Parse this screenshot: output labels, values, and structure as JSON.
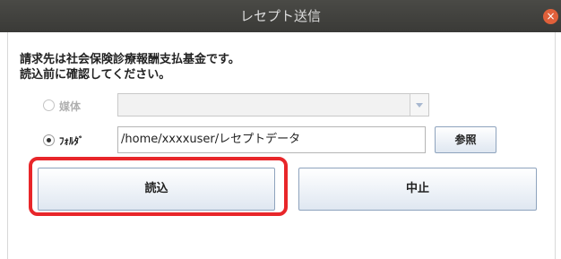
{
  "window": {
    "title": "レセプト送信",
    "close_glyph": "×"
  },
  "message": {
    "line1": "請求先は社会保険診療報酬支払基金です。",
    "line2": "読込前に確認してください。"
  },
  "source": {
    "media_label": "媒体",
    "media_selected": false,
    "media_value": "",
    "folder_label": "ﾌｫﾙﾀﾞ",
    "folder_selected": true,
    "folder_path": "/home/xxxxuser/レセプトデータ",
    "browse_label": "参照"
  },
  "actions": {
    "read_label": "読込",
    "cancel_label": "中止"
  },
  "annotation": {
    "highlight_color": "#e8262a"
  },
  "icons": [
    "close-icon",
    "chevron-down-icon",
    "radio-icon"
  ]
}
